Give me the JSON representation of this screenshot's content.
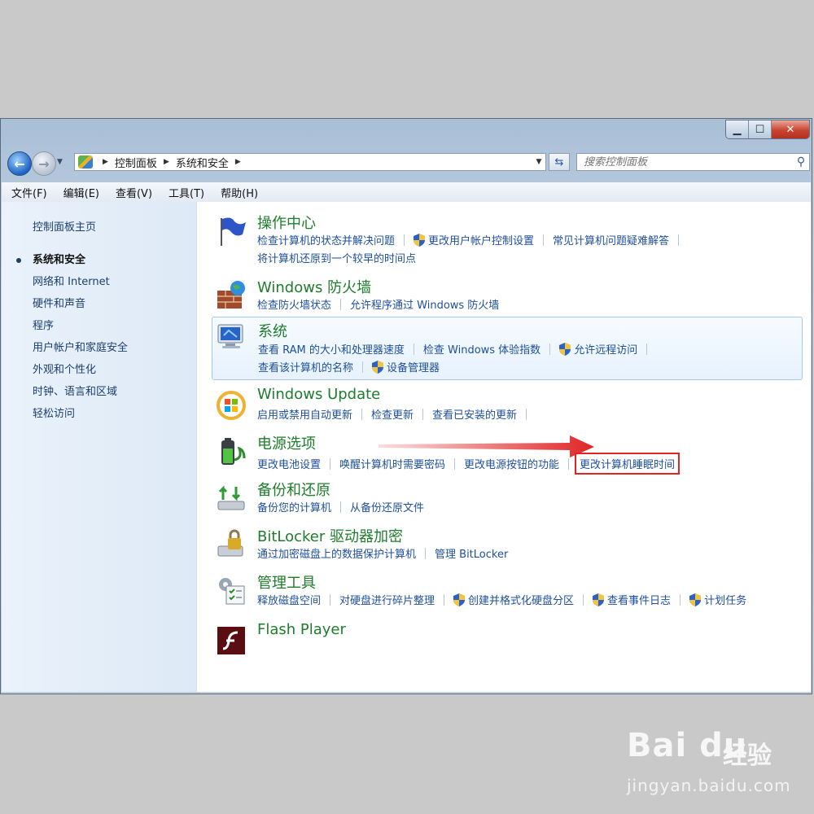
{
  "window": {
    "caption": {
      "minimize": "▁",
      "maximize": "☐",
      "close": "✕"
    }
  },
  "nav": {
    "back_glyph": "←",
    "forward_glyph": "→",
    "breadcrumbs": [
      "控制面板",
      "系统和安全"
    ],
    "search_placeholder": "搜索控制面板"
  },
  "menu": [
    "文件(F)",
    "编辑(E)",
    "查看(V)",
    "工具(T)",
    "帮助(H)"
  ],
  "sidebar": {
    "home": "控制面板主页",
    "items": [
      {
        "label": "系统和安全",
        "active": true
      },
      {
        "label": "网络和 Internet"
      },
      {
        "label": "硬件和声音"
      },
      {
        "label": "程序"
      },
      {
        "label": "用户帐户和家庭安全"
      },
      {
        "label": "外观和个性化"
      },
      {
        "label": "时钟、语言和区域"
      },
      {
        "label": "轻松访问"
      }
    ]
  },
  "categories": [
    {
      "key": "action-center",
      "title": "操作中心",
      "lines": [
        [
          {
            "text": "检查计算机的状态并解决问题"
          },
          {
            "text": "更改用户帐户控制设置",
            "shield": true
          },
          {
            "text": "常见计算机问题疑难解答"
          }
        ],
        [
          {
            "text": "将计算机还原到一个较早的时间点"
          }
        ]
      ]
    },
    {
      "key": "firewall",
      "title": "Windows 防火墙",
      "lines": [
        [
          {
            "text": "检查防火墙状态"
          },
          {
            "text": "允许程序通过 Windows 防火墙"
          }
        ]
      ]
    },
    {
      "key": "system",
      "title": "系统",
      "highlight": true,
      "lines": [
        [
          {
            "text": "查看 RAM 的大小和处理器速度"
          },
          {
            "text": "检查 Windows 体验指数"
          },
          {
            "text": "允许远程访问",
            "shield": true
          }
        ],
        [
          {
            "text": "查看该计算机的名称"
          },
          {
            "text": "设备管理器",
            "shield": true
          }
        ]
      ]
    },
    {
      "key": "windows-update",
      "title": "Windows Update",
      "lines": [
        [
          {
            "text": "启用或禁用自动更新"
          },
          {
            "text": "检查更新"
          },
          {
            "text": "查看已安装的更新"
          }
        ]
      ]
    },
    {
      "key": "power-options",
      "title": "电源选项",
      "lines": [
        [
          {
            "text": "更改电池设置"
          },
          {
            "text": "唤醒计算机时需要密码"
          },
          {
            "text": "更改电源按钮的功能"
          },
          {
            "text": "更改计算机睡眠时间",
            "boxed": true
          }
        ]
      ]
    },
    {
      "key": "backup",
      "title": "备份和还原",
      "lines": [
        [
          {
            "text": "备份您的计算机"
          },
          {
            "text": "从备份还原文件"
          }
        ]
      ]
    },
    {
      "key": "bitlocker",
      "title": "BitLocker 驱动器加密",
      "lines": [
        [
          {
            "text": "通过加密磁盘上的数据保护计算机"
          },
          {
            "text": "管理 BitLocker"
          }
        ]
      ]
    },
    {
      "key": "admin-tools",
      "title": "管理工具",
      "lines": [
        [
          {
            "text": "释放磁盘空间"
          },
          {
            "text": "对硬盘进行碎片整理"
          },
          {
            "text": "创建并格式化硬盘分区",
            "shield": true
          },
          {
            "text": "查看事件日志",
            "shield": true
          },
          {
            "text": "计划任务",
            "shield": true
          }
        ]
      ]
    },
    {
      "key": "flash-player",
      "title": "Flash Player",
      "lines": []
    }
  ],
  "watermark": {
    "logo": "Bai du",
    "cn": "经验",
    "url": "jingyan.baidu.com"
  },
  "colors": {
    "category_title": "#1e7d2c",
    "link": "#1e4f9c",
    "annotation_red": "#e02525"
  }
}
